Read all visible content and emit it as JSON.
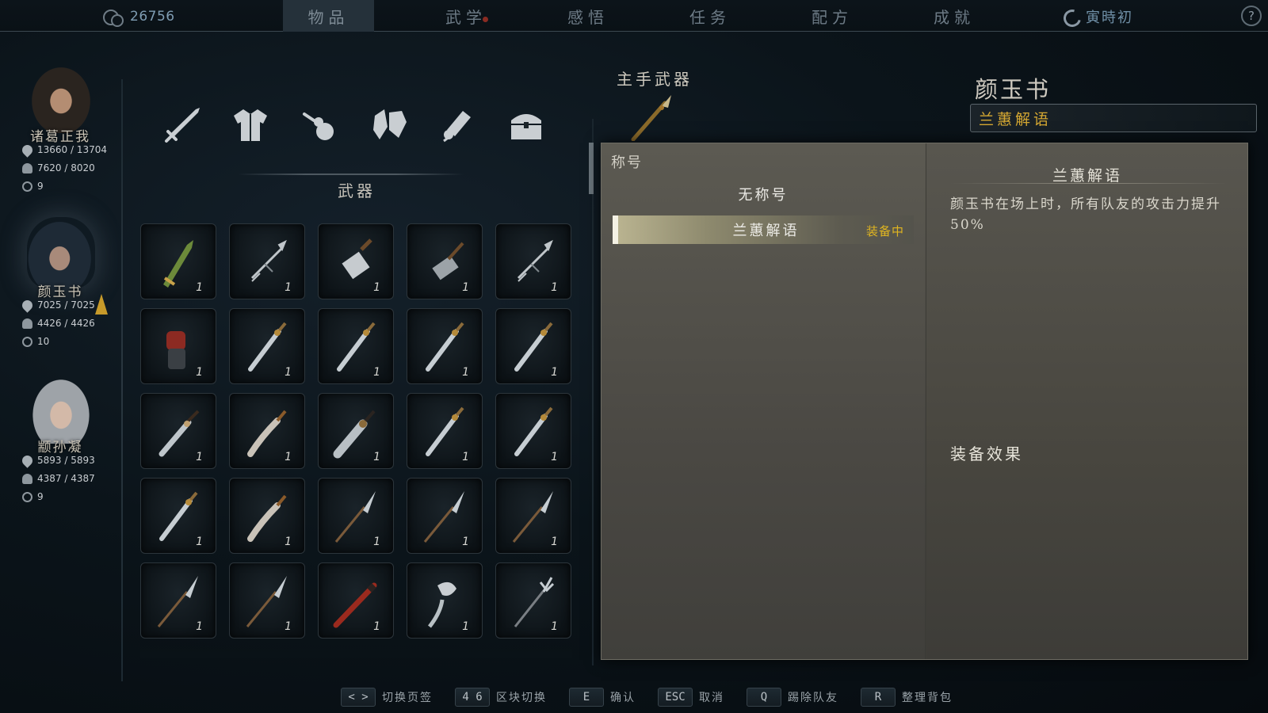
{
  "topbar": {
    "currency_icon": "coin-icon",
    "currency": "26756",
    "tabs": [
      {
        "label": "物品",
        "active": true
      },
      {
        "label": "武学",
        "badge": true
      },
      {
        "label": "感悟"
      },
      {
        "label": "任务"
      },
      {
        "label": "配方"
      },
      {
        "label": "成就"
      }
    ],
    "time_icon": "moon-clock-icon",
    "time": "寅時初",
    "help": "?"
  },
  "party": [
    {
      "name": "诸葛正我",
      "hp": "13660 / 13704",
      "mp": "7620 / 8020",
      "level": "9",
      "selected": false
    },
    {
      "name": "颜玉书",
      "hp": "7025 / 7025",
      "mp": "4426 / 4426",
      "level": "10",
      "selected": true
    },
    {
      "name": "颛孙凝",
      "hp": "5893 / 5893",
      "mp": "4387 / 4387",
      "level": "9",
      "selected": false
    }
  ],
  "categories": {
    "icons": [
      "sword-icon",
      "clothing-icon",
      "gourd-icon",
      "ore-icon",
      "scroll-icon",
      "chest-icon"
    ],
    "selected_title": "武器"
  },
  "inventory": {
    "items": [
      {
        "icon": "green-sword-icon",
        "qty": "1"
      },
      {
        "icon": "dart-icon",
        "qty": "1"
      },
      {
        "icon": "cleaver-icon",
        "qty": "1"
      },
      {
        "icon": "hammer-icon",
        "qty": "1"
      },
      {
        "icon": "dart-icon",
        "qty": "1"
      },
      {
        "icon": "gauntlet-icon",
        "qty": "1"
      },
      {
        "icon": "sword-icon",
        "qty": "1"
      },
      {
        "icon": "sword-icon",
        "qty": "1"
      },
      {
        "icon": "sword-icon",
        "qty": "1"
      },
      {
        "icon": "sword-icon",
        "qty": "1"
      },
      {
        "icon": "blade-icon",
        "qty": "1"
      },
      {
        "icon": "saber-icon",
        "qty": "1"
      },
      {
        "icon": "broadsword-icon",
        "qty": "1"
      },
      {
        "icon": "sword-icon",
        "qty": "1"
      },
      {
        "icon": "sword-icon",
        "qty": "1"
      },
      {
        "icon": "sword-icon",
        "qty": "1"
      },
      {
        "icon": "saber-icon",
        "qty": "1"
      },
      {
        "icon": "spear-icon",
        "qty": "1"
      },
      {
        "icon": "spear-icon",
        "qty": "1"
      },
      {
        "icon": "spear-icon",
        "qty": "1"
      },
      {
        "icon": "spear-icon",
        "qty": "1"
      },
      {
        "icon": "spear-icon",
        "qty": "1"
      },
      {
        "icon": "red-staff-icon",
        "qty": "1"
      },
      {
        "icon": "dragon-staff-icon",
        "qty": "1"
      },
      {
        "icon": "trident-icon",
        "qty": "1"
      }
    ]
  },
  "equipment": {
    "slot_label": "主手武器",
    "weapon_icon": "spear-icon"
  },
  "character": {
    "name": "颜玉书",
    "current_title": "兰蕙解语"
  },
  "title_dialog": {
    "header": "称号",
    "options": [
      {
        "label": "无称号"
      },
      {
        "label": "兰蕙解语",
        "selected": true,
        "tag": "装备中"
      }
    ],
    "detail_title": "兰蕙解语",
    "detail_desc": "颜玉书在场上时，所有队友的攻击力提升50%",
    "effect_heading": "装备效果"
  },
  "hints": [
    {
      "key": "< >",
      "label": "切换页签"
    },
    {
      "key": "4 6",
      "label": "区块切换"
    },
    {
      "key": "E",
      "label": "确认"
    },
    {
      "key": "ESC",
      "label": "取消"
    },
    {
      "key": "Q",
      "label": "踢除队友"
    },
    {
      "key": "R",
      "label": "整理背包"
    }
  ],
  "colors": {
    "accent_gold": "#d4a732",
    "equipped_tag": "#e0b520",
    "panel_bg": "#4a4843",
    "background": "#0b141a"
  }
}
